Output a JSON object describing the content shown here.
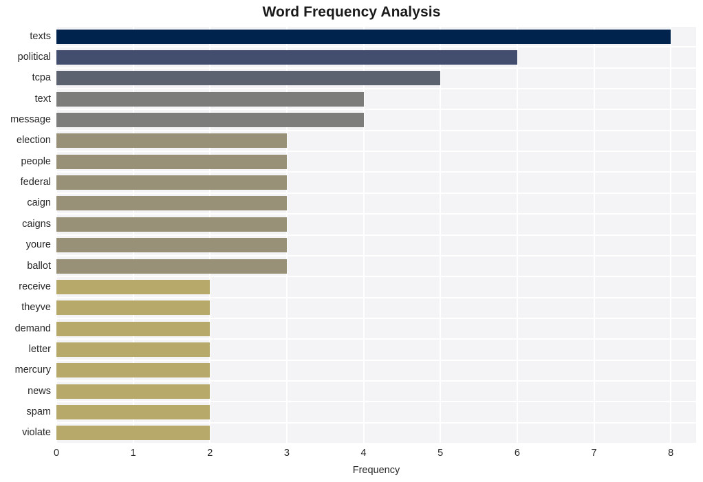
{
  "chart_data": {
    "type": "bar",
    "orientation": "horizontal",
    "title": "Word Frequency Analysis",
    "xlabel": "Frequency",
    "ylabel": "",
    "xlim": [
      0,
      8.33
    ],
    "grid": true,
    "legend": false,
    "categories": [
      "texts",
      "political",
      "tcpa",
      "text",
      "message",
      "election",
      "people",
      "federal",
      "caign",
      "caigns",
      "youre",
      "ballot",
      "receive",
      "theyve",
      "demand",
      "letter",
      "mercury",
      "news",
      "spam",
      "violate"
    ],
    "values": [
      8,
      6,
      5,
      4,
      4,
      3,
      3,
      3,
      3,
      3,
      3,
      3,
      2,
      2,
      2,
      2,
      2,
      2,
      2,
      2
    ],
    "bar_colors": [
      "#00234e",
      "#434d6d",
      "#5c6270",
      "#7c7c7a",
      "#7d7d7b",
      "#989177",
      "#989177",
      "#989177",
      "#989177",
      "#989177",
      "#989177",
      "#989177",
      "#b6a96a",
      "#b6a96a",
      "#b6a96a",
      "#b6a96a",
      "#b6a96a",
      "#b6a96a",
      "#b6a96a",
      "#b6a96a"
    ],
    "xticks": [
      0,
      1,
      2,
      3,
      4,
      5,
      6,
      7,
      8
    ],
    "xtick_labels": [
      "0",
      "1",
      "2",
      "3",
      "4",
      "5",
      "6",
      "7",
      "8"
    ],
    "plot_background": "#f4f4f6",
    "grid_color": "#ffffff",
    "figure_background": "#ffffff",
    "text_color": "#262626",
    "title_color": "#1a1a1a"
  }
}
